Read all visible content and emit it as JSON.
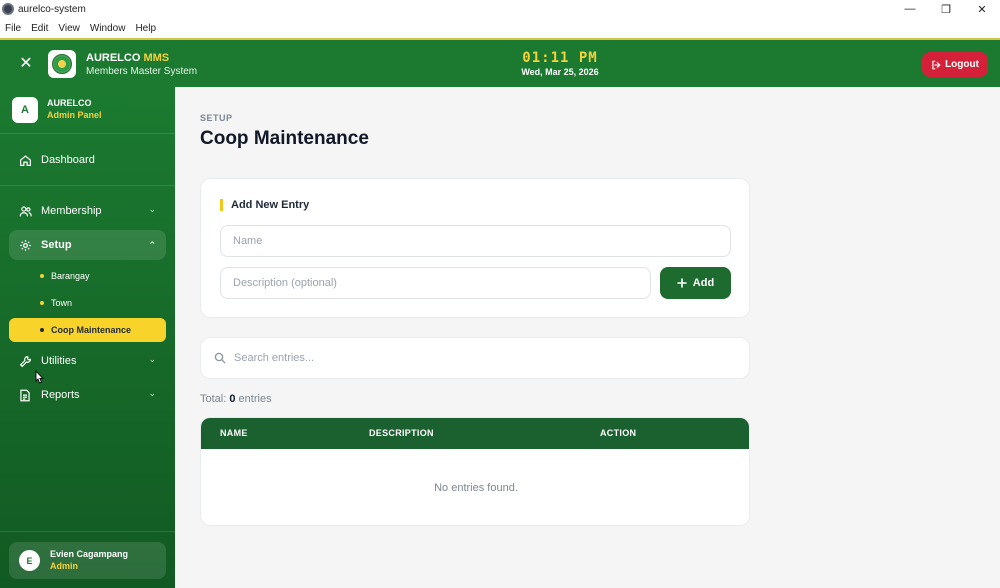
{
  "window": {
    "title": "aurelco-system",
    "controls": {
      "minimize": "—",
      "restore": "❐",
      "close": "✕"
    }
  },
  "menubar": [
    "File",
    "Edit",
    "View",
    "Window",
    "Help"
  ],
  "header": {
    "close_glyph": "✕",
    "brand_main": "AURELCO",
    "brand_accent": "MMS",
    "brand_sub": "Members Master System",
    "time": "01:11 PM",
    "date": "Wed, Mar 25, 2026",
    "logout_label": "Logout"
  },
  "sidebar": {
    "avatar_letter": "A",
    "org": "AURELCO",
    "panel": "Admin Panel",
    "items": {
      "dashboard": "Dashboard",
      "membership": "Membership",
      "setup": "Setup",
      "utilities": "Utilities",
      "reports": "Reports"
    },
    "setup_children": [
      "Barangay",
      "Town",
      "Coop Maintenance"
    ],
    "active_child": "Coop Maintenance",
    "footer": {
      "avatar_letter": "E",
      "name": "Evien Cagampang",
      "role": "Admin"
    }
  },
  "main": {
    "breadcrumb": "SETUP",
    "title": "Coop Maintenance",
    "form": {
      "title": "Add New Entry",
      "name_placeholder": "Name",
      "description_placeholder": "Description (optional)",
      "add_label": "Add"
    },
    "search_placeholder": "Search entries...",
    "total_prefix": "Total:",
    "total_count": "0",
    "total_suffix": "entries",
    "table": {
      "columns": [
        "NAME",
        "DESCRIPTION",
        "ACTION"
      ],
      "rows": [],
      "empty_message": "No entries found."
    }
  },
  "colors": {
    "primary_green": "#1b7a30",
    "accent_yellow": "#f5d13a",
    "logout_red": "#d5203a"
  }
}
